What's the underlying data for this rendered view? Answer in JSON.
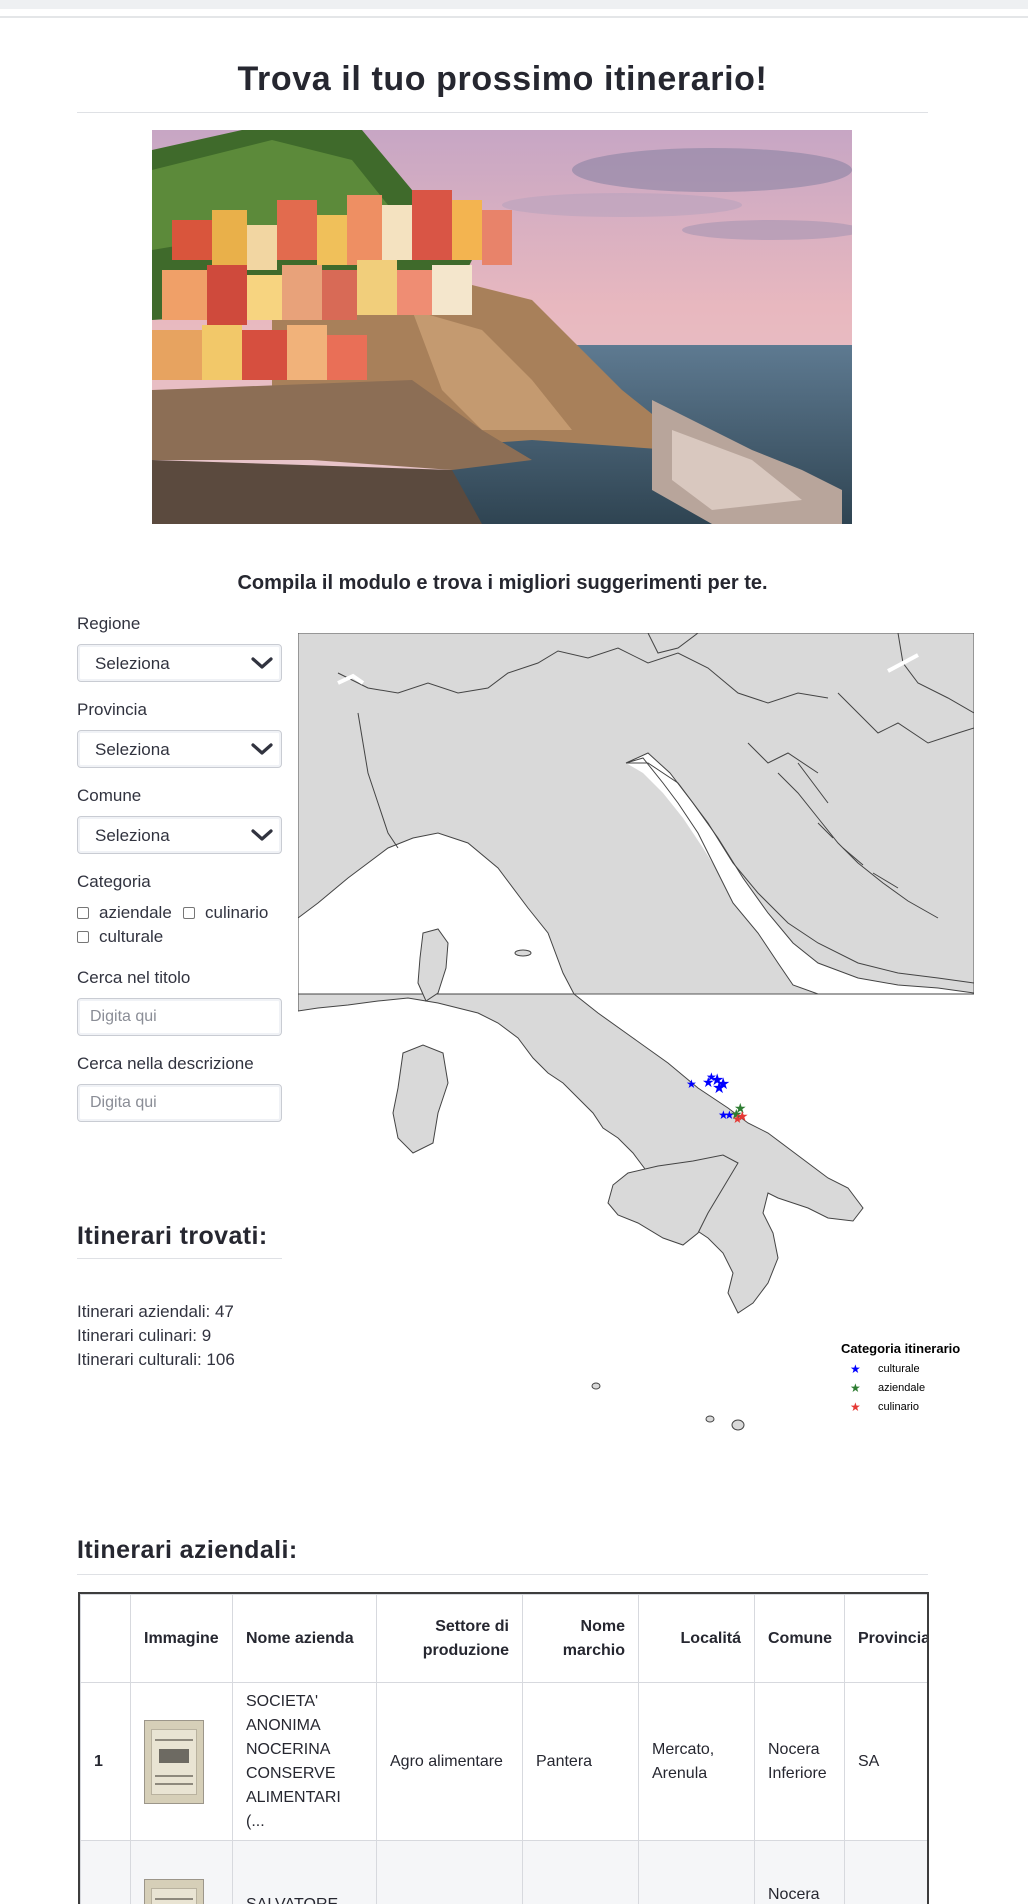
{
  "page": {
    "title": "Trova il tuo prossimo itinerario!",
    "subtitle": "Compila il modulo e trova i migliori suggerimenti per te."
  },
  "hero_image": {
    "description_icon": "landscape-photo"
  },
  "form": {
    "regione": {
      "label": "Regione",
      "value": "Seleziona"
    },
    "provincia": {
      "label": "Provincia",
      "value": "Seleziona"
    },
    "comune": {
      "label": "Comune",
      "value": "Seleziona"
    },
    "categoria": {
      "label": "Categoria",
      "options": [
        "aziendale",
        "culinario",
        "culturale"
      ]
    },
    "cerca_titolo": {
      "label": "Cerca nel titolo",
      "placeholder": "Digita qui"
    },
    "cerca_descrizione": {
      "label": "Cerca nella descrizione",
      "placeholder": "Digita qui"
    }
  },
  "results": {
    "heading": "Itinerari trovati:",
    "counts": [
      "Itinerari aziendali: 47",
      "Itinerari culinari: 9",
      "Itinerari culturali: 106"
    ]
  },
  "map": {
    "legend_title": "Categoria itinerario",
    "legend": [
      {
        "label": "culturale",
        "color": "#0000ff"
      },
      {
        "label": "aziendale",
        "color": "#2e7d32"
      },
      {
        "label": "culinario",
        "color": "#e53935"
      }
    ],
    "land_color": "#d9d9d9",
    "sea_color": "#ffffff"
  },
  "aziendali": {
    "heading": "Itinerari aziendali:",
    "columns": [
      "",
      "Immagine",
      "Nome azienda",
      "Settore di produzione",
      "Nome marchio",
      "Localitá",
      "Comune",
      "Provincia"
    ],
    "rows": [
      {
        "index": "1",
        "nome_azienda": "SOCIETA' ANONIMA NOCERINA CONSERVE ALIMENTARI (...",
        "settore": "Agro alimentare",
        "marchio": "Pantera",
        "localita": "Mercato, Arenula",
        "comune": "Nocera Inferiore",
        "provincia": "SA"
      },
      {
        "index": "",
        "nome_azienda": "SALVATORE",
        "settore": "",
        "marchio": "",
        "localita": "",
        "comune": "Nocera",
        "provincia": ""
      }
    ]
  }
}
